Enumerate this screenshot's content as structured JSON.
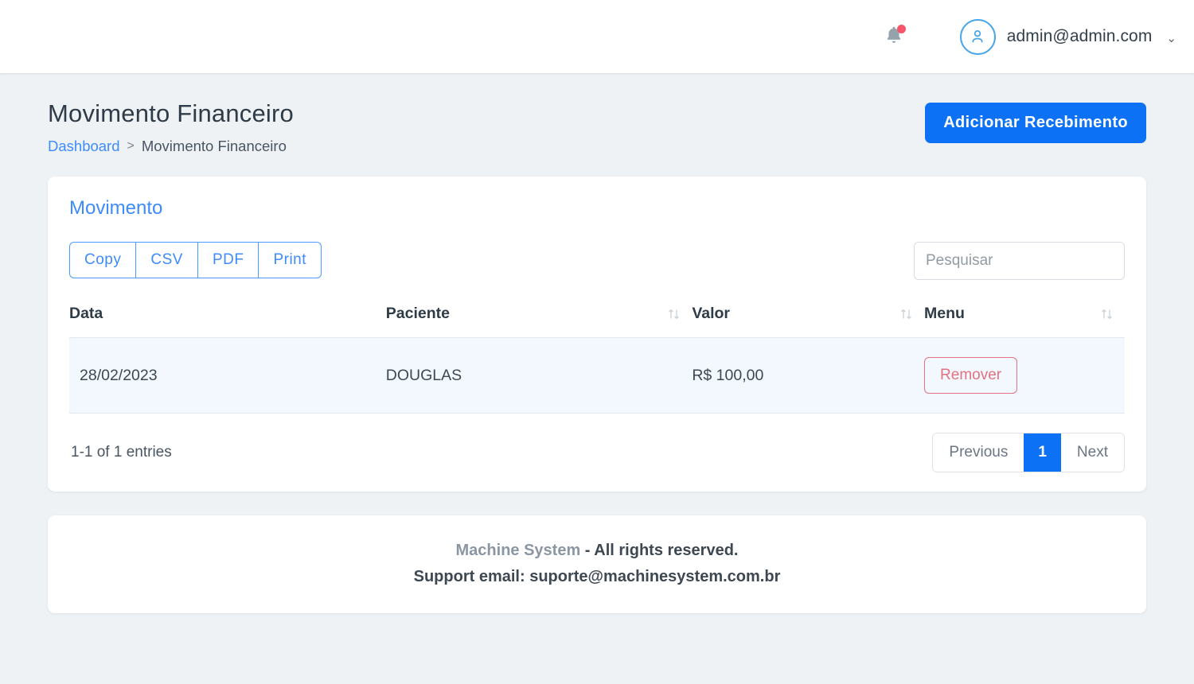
{
  "navbar": {
    "notifications_icon": "bell-icon",
    "has_notification_badge": true,
    "user_email": "admin@admin.com",
    "caret": "⌄",
    "avatar_icon": "user-icon"
  },
  "page": {
    "title": "Movimento Financeiro",
    "breadcrumb": {
      "root": "Dashboard",
      "separator": ">",
      "current": "Movimento Financeiro"
    },
    "primary_action": "Adicionar Recebimento"
  },
  "card": {
    "title": "Movimento",
    "export_buttons": [
      "Copy",
      "CSV",
      "PDF",
      "Print"
    ],
    "search": {
      "placeholder": "Pesquisar",
      "value": ""
    },
    "table": {
      "columns": [
        "Data",
        "Paciente",
        "Valor",
        "Menu"
      ],
      "sort_icon": "sort-arrows-icon",
      "rows": [
        {
          "data": "28/02/2023",
          "paciente": "DOUGLAS",
          "valor": "R$ 100,00",
          "menu_action": "Remover"
        }
      ]
    },
    "entries_info": "1-1 of 1 entries",
    "pagination": {
      "previous": "Previous",
      "pages": [
        "1"
      ],
      "active_page": "1",
      "next": "Next"
    }
  },
  "footer": {
    "brand": "Machine System",
    "rights": " - All rights reserved.",
    "support": "Support email: suporte@machinesystem.com.br"
  },
  "colors": {
    "accent_blue": "#0d71f5",
    "link_blue": "#3d8bfd",
    "danger_red": "#e2727f",
    "badge_red": "#f8556d",
    "page_bg": "#eef2f5",
    "row_bg": "#f2f8fd"
  }
}
